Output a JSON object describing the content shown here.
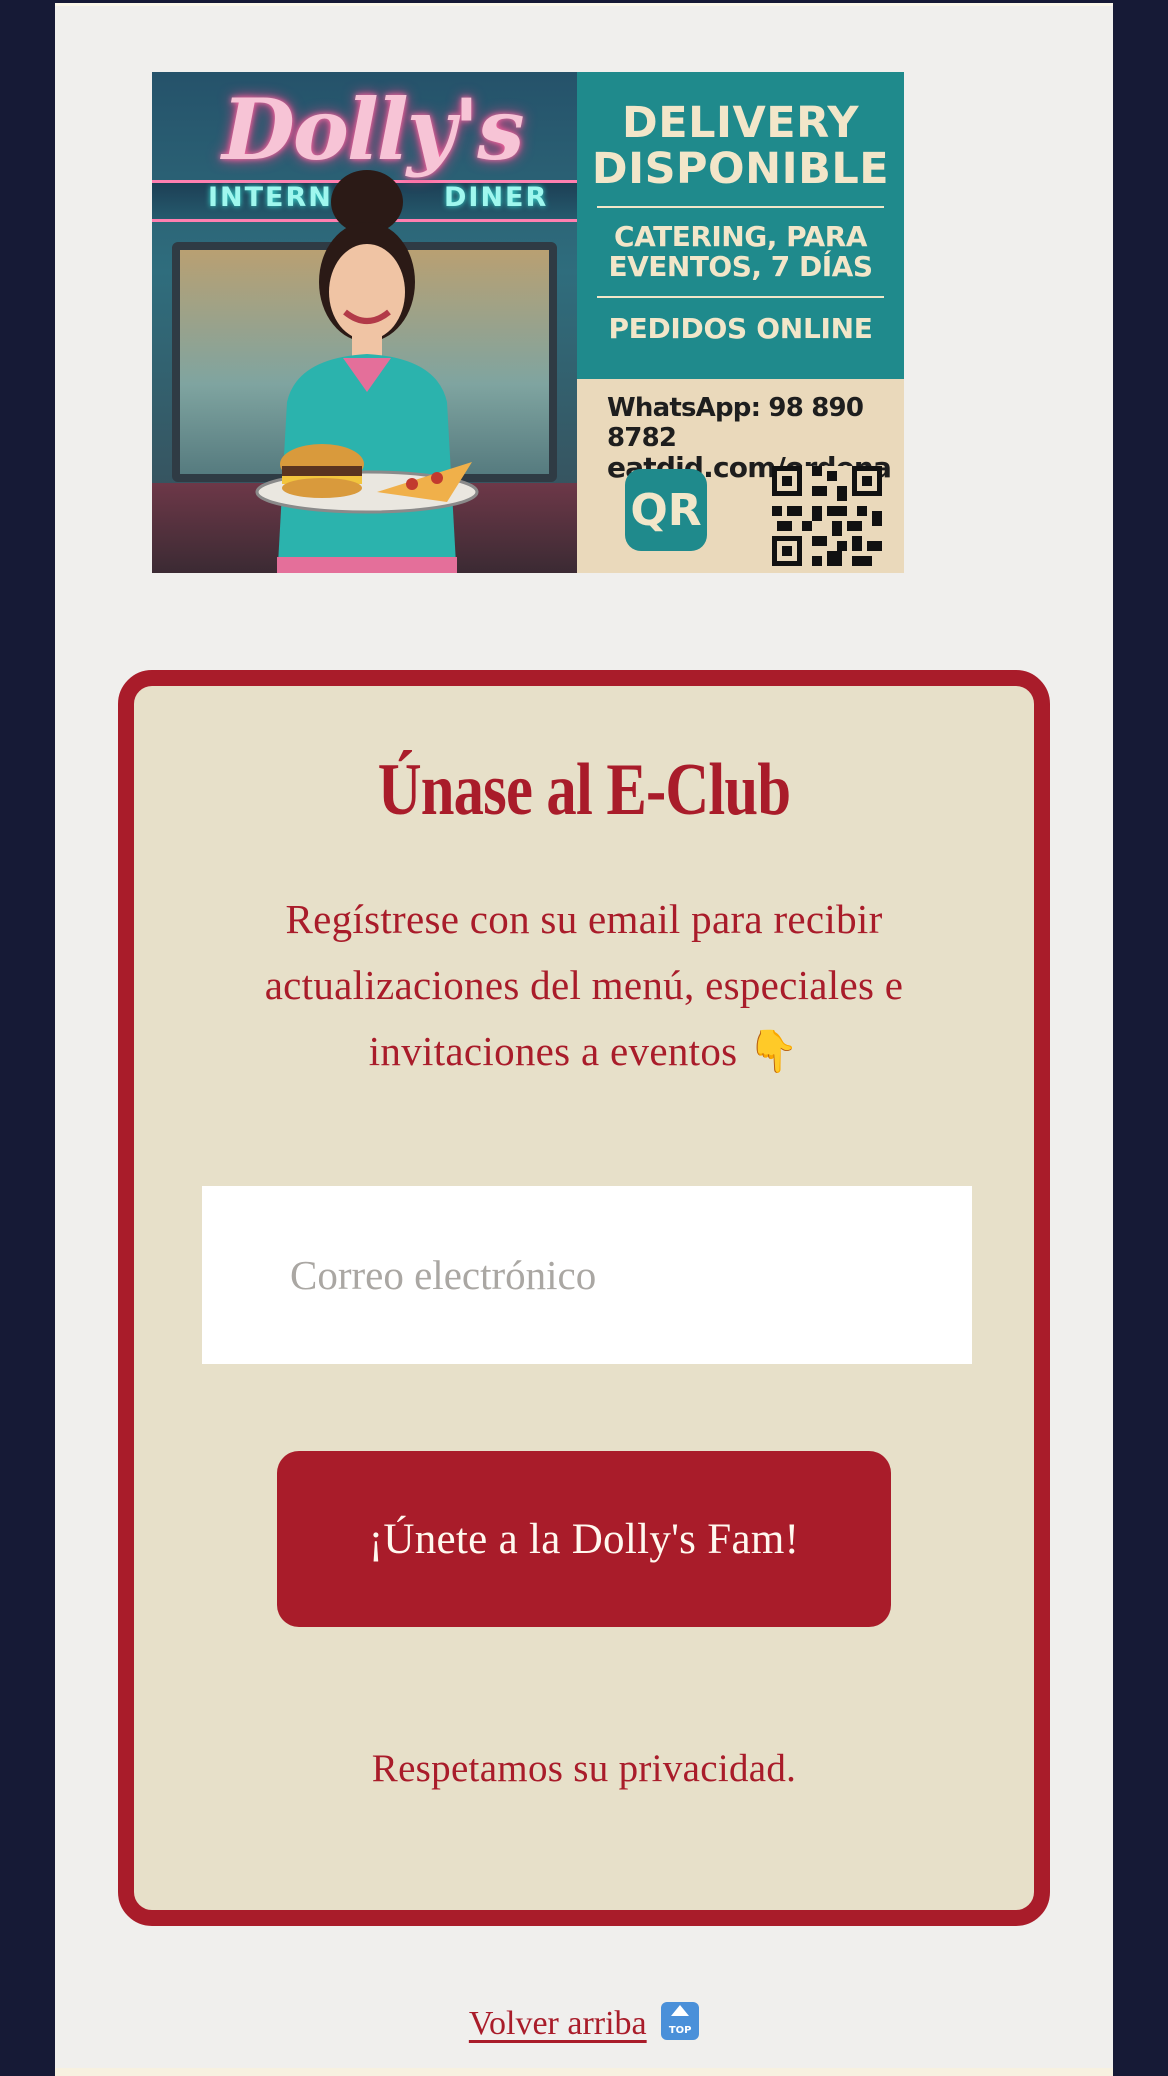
{
  "banner": {
    "sign_name": "Dolly's",
    "sign_sub_left": "INTERN",
    "sign_sub_right": "DINER",
    "delivery_title": "DELIVERY DISPONIBLE",
    "catering": "CATERING, PARA EVENTOS, 7 DÍAS",
    "pedidos": "PEDIDOS ONLINE",
    "whatsapp": "WhatsApp: 98 890 8782",
    "url": "eatdid.com/ordena",
    "qr_badge": "QR"
  },
  "eclub": {
    "title": "Únase al E-Club",
    "description": "Regístrese con su email para recibir actualizaciones del menú, especiales e invitaciones a eventos 👇",
    "email_placeholder": "Correo electrónico",
    "submit_label": "¡Únete a la Dolly's Fam!",
    "privacy_note": "Respetamos su privacidad."
  },
  "footer": {
    "back_to_top": "Volver arriba",
    "back_to_top_icon": "TOP"
  },
  "colors": {
    "accent_red": "#a91c2a",
    "card_bg": "#e7e0c9",
    "page_bg": "#f0efed",
    "outer_bg": "#161a36",
    "teal": "#1f8a8c",
    "cream": "#ead9bb"
  }
}
